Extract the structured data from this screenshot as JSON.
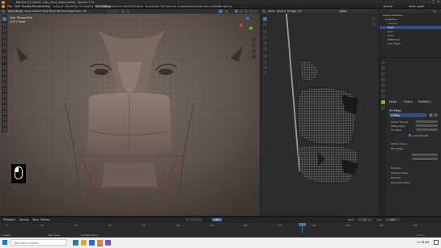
{
  "window": {
    "title": "Blender* [C:\\Users\\...\\lion_head_retopo.blend] - Blender 2.91"
  },
  "menubar": {
    "menus": [
      "File",
      "Edit",
      "Render",
      "Window",
      "Help"
    ],
    "workspaces": [
      "Layout",
      "Modeling",
      "Sculpting",
      "UV Editing",
      "Texture Paint",
      "Shading",
      "Animation",
      "Rendering",
      "Compositing",
      "Geometry Nodes",
      "Scripting"
    ],
    "active_workspace": "UV Editing",
    "scene": "Scene",
    "view_layer": "View Layer"
  },
  "viewport": {
    "mode": "Edit Mode",
    "menus": [
      "View",
      "Select",
      "Add",
      "Mesh",
      "Vertex",
      "Edge",
      "Face",
      "UV"
    ],
    "overlay_title": "User Perspective",
    "overlay_object": "(197) Head"
  },
  "uv_editor": {
    "menus": [
      "View",
      "Select",
      "Image",
      "UV"
    ],
    "image_name": "New"
  },
  "outliner": {
    "title": "Scene Collection",
    "items": [
      "Collection",
      "Camera",
      "Head",
      "Eyes",
      "Teeth",
      "Reference",
      "Lion_Head"
    ]
  },
  "properties": {
    "object_name": "Head",
    "tabs": [
      "Object",
      "Modifiers"
    ],
    "section_uv_maps": "UV Maps",
    "uv_map_name": "UVMap",
    "rows": [
      {
        "label": "Vertex Groups",
        "value": ""
      },
      {
        "label": "Shape Keys",
        "value": ""
      },
      {
        "label": "UV Maps",
        "value": "UVMap"
      },
      {
        "label": "Vertex Colors",
        "value": ""
      },
      {
        "label": "Face Maps",
        "value": ""
      },
      {
        "label": "Normals",
        "value": ""
      },
      {
        "label": "Texture Space",
        "value": ""
      },
      {
        "label": "Remesh",
        "value": ""
      },
      {
        "label": "Geometry Data",
        "value": ""
      }
    ],
    "auto_smooth_label": "Auto Smooth"
  },
  "timeline": {
    "menus": [
      "Playback",
      "Keying",
      "View",
      "Marker"
    ],
    "frame_current": "197",
    "start_label": "Start",
    "start_value": "1",
    "end_label": "End",
    "end_value": "250",
    "ticks": [
      "0",
      "20",
      "40",
      "60",
      "80",
      "100",
      "120",
      "140",
      "160",
      "180",
      "200",
      "220",
      "240"
    ]
  },
  "statusbar": {
    "left": "Select",
    "middle": "Pan View",
    "right": "Context Menu",
    "version": "2.91.0"
  },
  "taskbar": {
    "search_placeholder": "Type here to search",
    "clock": "11:36 AM"
  },
  "colors": {
    "accent": "#4772b3",
    "active_orange": "#e38a2b",
    "mesh_fill": "#6e6259"
  }
}
